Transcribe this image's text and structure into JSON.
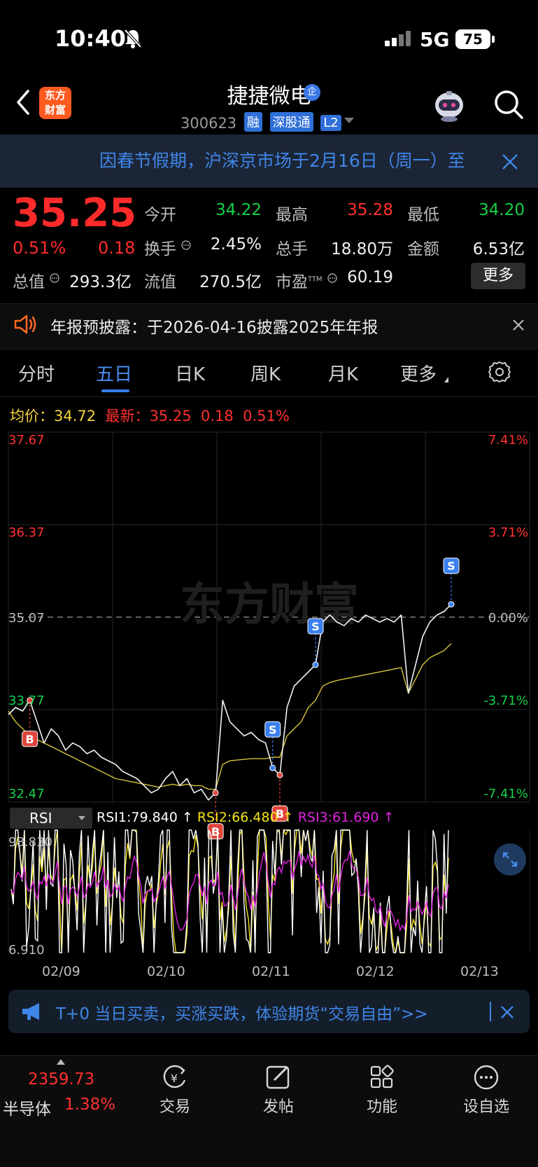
{
  "status_bar": {
    "time": "10:40",
    "network": "5G",
    "battery": "75"
  },
  "header": {
    "stock_name": "捷捷微电",
    "enterprise_badge": "企",
    "logo_line1": "东方",
    "logo_line2": "财富",
    "code": "300623",
    "tags": [
      "融",
      "深股通",
      "L2"
    ]
  },
  "notice": {
    "text": "因春节假期，沪深京市场于2月16日（周一）至"
  },
  "quote": {
    "price": "35.25",
    "change_pct": "0.51%",
    "change": "0.18",
    "fields": [
      {
        "label": "今开",
        "value": "34.22",
        "color": "down"
      },
      {
        "label": "最高",
        "value": "35.28",
        "color": "up"
      },
      {
        "label": "最低",
        "value": "34.20",
        "color": "down"
      },
      {
        "label": "换手",
        "value": "2.45%",
        "color": "neutral"
      },
      {
        "label": "总手",
        "value": "18.80万",
        "color": "neutral"
      },
      {
        "label": "金额",
        "value": "6.53亿",
        "color": "neutral"
      },
      {
        "label": "总值",
        "value": "293.3亿",
        "color": "neutral"
      },
      {
        "label": "流值",
        "value": "270.5亿",
        "color": "neutral"
      },
      {
        "label": "市盈",
        "label_sup": "TTM",
        "value": "60.19",
        "color": "neutral"
      }
    ],
    "more_button": "更多"
  },
  "announcement": {
    "text": "年报预披露：于2026-04-16披露2025年年报"
  },
  "tabs": [
    "分时",
    "五日",
    "日K",
    "周K",
    "月K",
    "更多"
  ],
  "active_tab": "五日",
  "chart_header": {
    "avg_label": "均价：",
    "avg_value": "34.72",
    "latest_label": "最新：",
    "latest_value": "35.25",
    "latest_change": "0.18",
    "latest_pct": "0.51%"
  },
  "chart_data": {
    "type": "line",
    "watermark": "东方财富",
    "y_left_ticks": [
      "37.67",
      "36.37",
      "35.07",
      "33.77",
      "32.47"
    ],
    "y_right_ticks": [
      "7.41%",
      "3.71%",
      "0.00%",
      "-3.71%",
      "-7.41%"
    ],
    "ylim": [
      32.47,
      37.67
    ],
    "prev_close": 35.07,
    "x_labels": [
      "02/09",
      "02/10",
      "02/11",
      "02/12",
      "02/13"
    ],
    "series": [
      {
        "name": "价格",
        "values": [
          33.7,
          33.8,
          33.75,
          33.9,
          33.6,
          33.3,
          33.5,
          33.4,
          33.2,
          33.3,
          33.25,
          33.15,
          33.2,
          33.1,
          33.05,
          33.0,
          32.9,
          32.85,
          32.8,
          32.7,
          32.6,
          32.65,
          32.8,
          32.9,
          32.7,
          32.8,
          32.6,
          32.65,
          32.5,
          32.6,
          33.9,
          33.6,
          33.5,
          33.4,
          33.45,
          33.35,
          33.3,
          32.95,
          32.85,
          33.8,
          34.1,
          34.2,
          34.3,
          34.4,
          35.0,
          35.1,
          35.0,
          34.95,
          35.05,
          35.0,
          35.1,
          35.05,
          35.0,
          35.05,
          35.0,
          35.1,
          34.0,
          34.4,
          34.8,
          35.0,
          35.1,
          35.15,
          35.25
        ]
      },
      {
        "name": "均价",
        "values": [
          33.75,
          33.6,
          33.5,
          33.4,
          33.35,
          33.3,
          33.25,
          33.2,
          33.15,
          33.1,
          33.05,
          33.0,
          32.95,
          32.9,
          32.85,
          32.8,
          32.78,
          32.76,
          32.74,
          32.72,
          32.7,
          32.68,
          32.7,
          32.72,
          32.7,
          32.72,
          32.7,
          32.7,
          32.65,
          32.65,
          33.0,
          33.05,
          33.06,
          33.07,
          33.08,
          33.08,
          33.08,
          33.1,
          33.1,
          33.4,
          33.5,
          33.6,
          33.8,
          33.9,
          34.1,
          34.15,
          34.18,
          34.2,
          34.22,
          34.24,
          34.26,
          34.28,
          34.3,
          34.32,
          34.34,
          34.36,
          34.0,
          34.2,
          34.4,
          34.5,
          34.55,
          34.6,
          34.7
        ]
      }
    ],
    "trade_markers": [
      "B",
      "B",
      "S",
      "B",
      "S",
      "S"
    ]
  },
  "rsi": {
    "selector": "RSI",
    "rsi1": "RSI1:79.840 ↑",
    "rsi2": "RSI2:66.480 ↑",
    "rsi3": "RSI3:61.690 ↑",
    "max": "98.830",
    "min": "6.910",
    "colors": {
      "rsi1": "#ffffff",
      "rsi2": "#f5e31e",
      "rsi3": "#e025e0"
    }
  },
  "promo": {
    "text": "T+0 当日买卖，买涨买跌，体验期货“交易自由”>>"
  },
  "bottom_nav": {
    "index_value": "2359.73",
    "index_name": "半导体",
    "index_pct": "1.38%",
    "items": [
      "交易",
      "发帖",
      "功能",
      "设自选"
    ]
  }
}
